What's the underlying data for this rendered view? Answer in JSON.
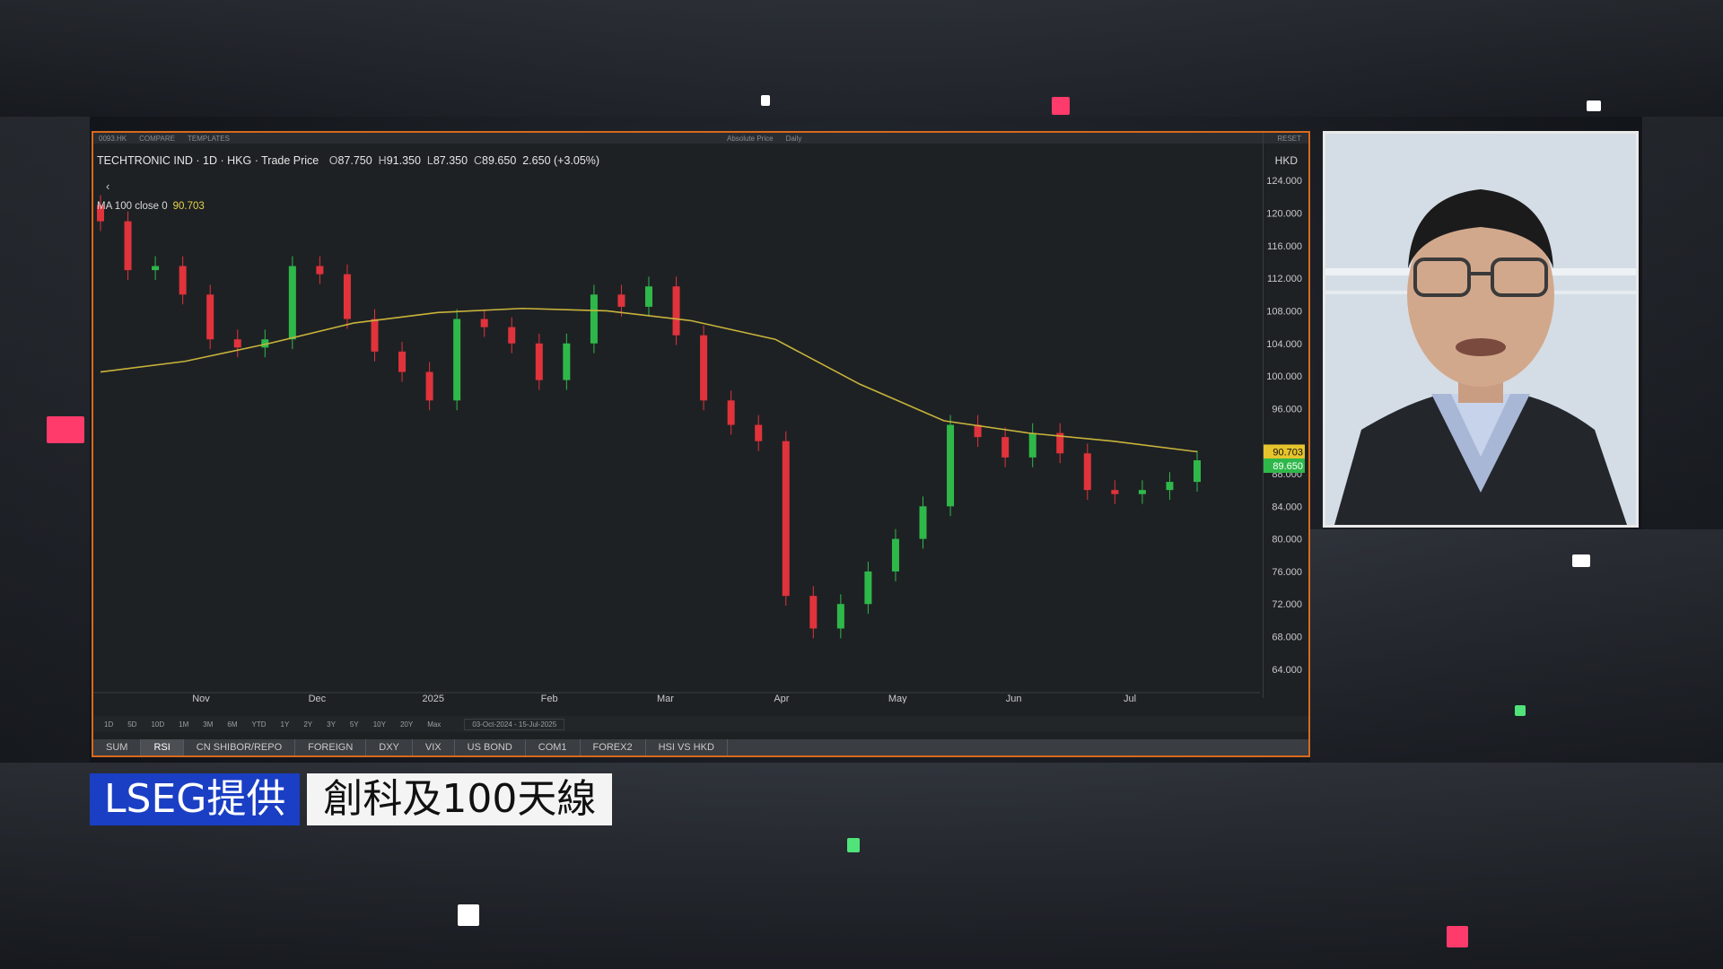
{
  "topbar": {
    "items": [
      "0093.HK",
      "COMPARE",
      "TEMPLATES",
      "Absolute Price",
      "Daily"
    ],
    "reset": "RESET"
  },
  "chart": {
    "instrument": "TECHTRONIC IND · 1D · HKG · Trade Price",
    "ohlc": {
      "o_label": "O",
      "o": "87.750",
      "h_label": "H",
      "h": "91.350",
      "l_label": "L",
      "l": "87.350",
      "c_label": "C",
      "c": "89.650",
      "change": "2.650 (+3.05%)"
    },
    "collapse_icon": "‹",
    "ma_label": "MA 100 close 0",
    "ma_value": "90.703",
    "currency": "HKD"
  },
  "chart_data": {
    "type": "candlestick",
    "currency": "HKD",
    "ylim": [
      62,
      127
    ],
    "yticks": [
      "124.000",
      "120.000",
      "116.000",
      "112.000",
      "108.000",
      "104.000",
      "100.000",
      "96.000",
      "88.000",
      "84.000",
      "80.000",
      "76.000",
      "72.000",
      "68.000",
      "64.000"
    ],
    "xticks": [
      "Nov",
      "Dec",
      "2025",
      "Feb",
      "Mar",
      "Apr",
      "May",
      "Jun",
      "Jul"
    ],
    "price_label": "89.650",
    "ma_label_value": "90.703",
    "series": [
      {
        "name": "MA 100 close 0",
        "type": "line",
        "color": "#c8b43a",
        "values": [
          100.5,
          101.8,
          104.0,
          106.5,
          107.8,
          108.3,
          108.0,
          106.8,
          104.5,
          99.0,
          94.5,
          93.0,
          92.0,
          90.7
        ]
      },
      {
        "type": "candles",
        "up_color": "#2fb84a",
        "down_color": "#e0333b",
        "closes": [
          119.0,
          113.0,
          113.5,
          110.0,
          104.5,
          103.5,
          104.5,
          113.5,
          112.5,
          107.0,
          103.0,
          100.5,
          97.0,
          107.0,
          106.0,
          104.0,
          99.5,
          104.0,
          110.0,
          108.5,
          111.0,
          105.0,
          97.0,
          94.0,
          92.0,
          73.0,
          69.0,
          72.0,
          76.0,
          80.0,
          84.0,
          94.0,
          92.5,
          90.0,
          93.0,
          90.5,
          86.0,
          85.5,
          86.0,
          87.0,
          89.65
        ]
      }
    ]
  },
  "controls": {
    "ranges": [
      "1D",
      "5D",
      "10D",
      "1M",
      "3M",
      "6M",
      "YTD",
      "1Y",
      "2Y",
      "3Y",
      "5Y",
      "10Y",
      "20Y",
      "Max"
    ],
    "date_from": "03-Oct-2024",
    "date_to": "15-Jul-2025"
  },
  "tabs": [
    "SUM",
    "RSI",
    "CN SHIBOR/REPO",
    "FOREIGN",
    "DXY",
    "VIX",
    "US BOND",
    "COM1",
    "FOREX2",
    "HSI VS HKD"
  ],
  "caption": {
    "source": "LSEG提供",
    "title": "創科及100天線"
  },
  "colors": {
    "accent_border": "#d8691d",
    "caption_blue": "#1a3fc4",
    "up": "#2fb84a",
    "down": "#e0333b",
    "ma": "#c8b43a"
  }
}
